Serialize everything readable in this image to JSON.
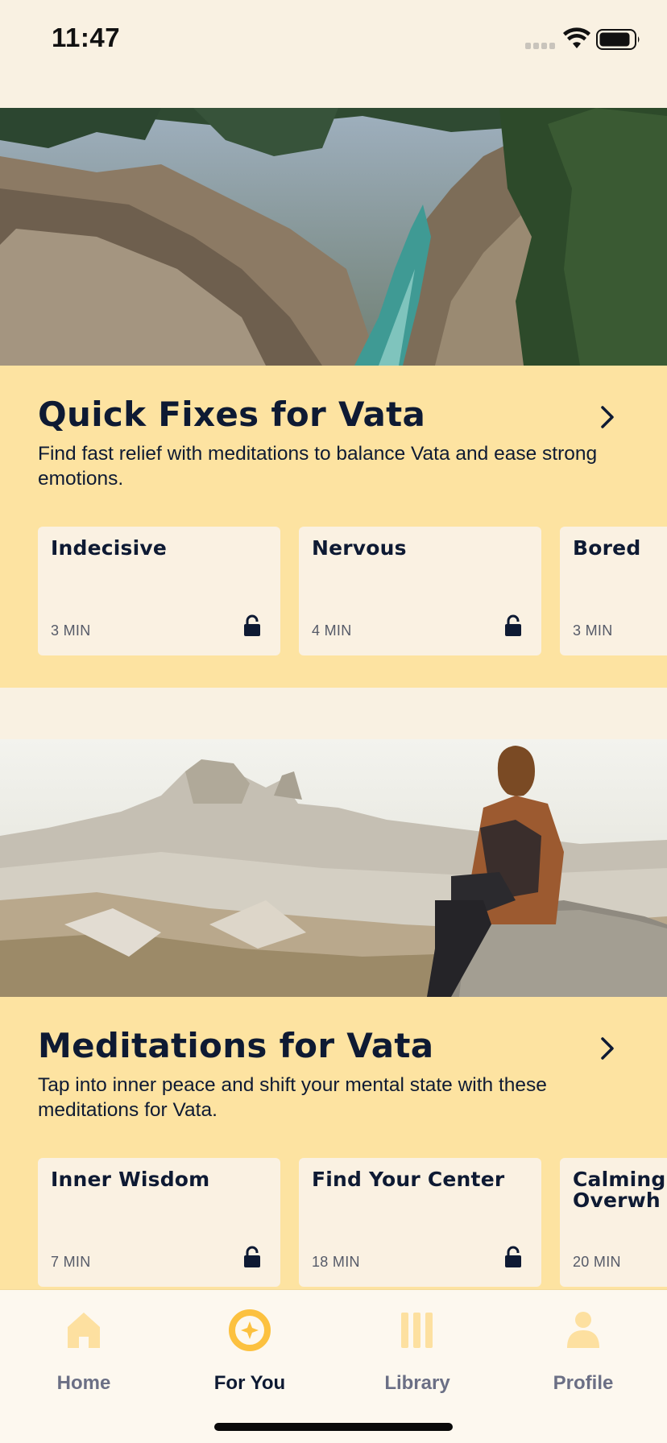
{
  "status_bar": {
    "time": "11:47"
  },
  "sections": [
    {
      "title": "Quick Fixes for Vata",
      "description": "Find fast relief with meditations to balance Vata and ease strong emotions.",
      "cards": [
        {
          "title": "Indecisive",
          "duration": "3 MIN",
          "locked": true
        },
        {
          "title": "Nervous",
          "duration": "4 MIN",
          "locked": true
        },
        {
          "title": "Bored",
          "duration": "3 MIN",
          "locked": true
        }
      ]
    },
    {
      "title": "Meditations for Vata",
      "description": "Tap into inner peace and shift your mental state with these meditations for Vata.",
      "cards": [
        {
          "title": "Inner Wisdom",
          "duration": "7 MIN",
          "locked": true
        },
        {
          "title": "Find Your Center",
          "duration": "18 MIN",
          "locked": true
        },
        {
          "title": "Calming Overwh",
          "duration": "20 MIN",
          "locked": true
        }
      ]
    }
  ],
  "tab_bar": {
    "items": [
      {
        "label": "Home",
        "icon": "home-icon",
        "active": false
      },
      {
        "label": "For You",
        "icon": "compass-star-icon",
        "active": true
      },
      {
        "label": "Library",
        "icon": "library-icon",
        "active": false
      },
      {
        "label": "Profile",
        "icon": "profile-icon",
        "active": false
      }
    ]
  },
  "colors": {
    "background": "#f9f1e2",
    "section_background": "#fde3a1",
    "card_background": "#faf1e2",
    "text_dark": "#0e1a33",
    "accent": "#fcc13f",
    "tab_inactive": "#6b6f85"
  }
}
